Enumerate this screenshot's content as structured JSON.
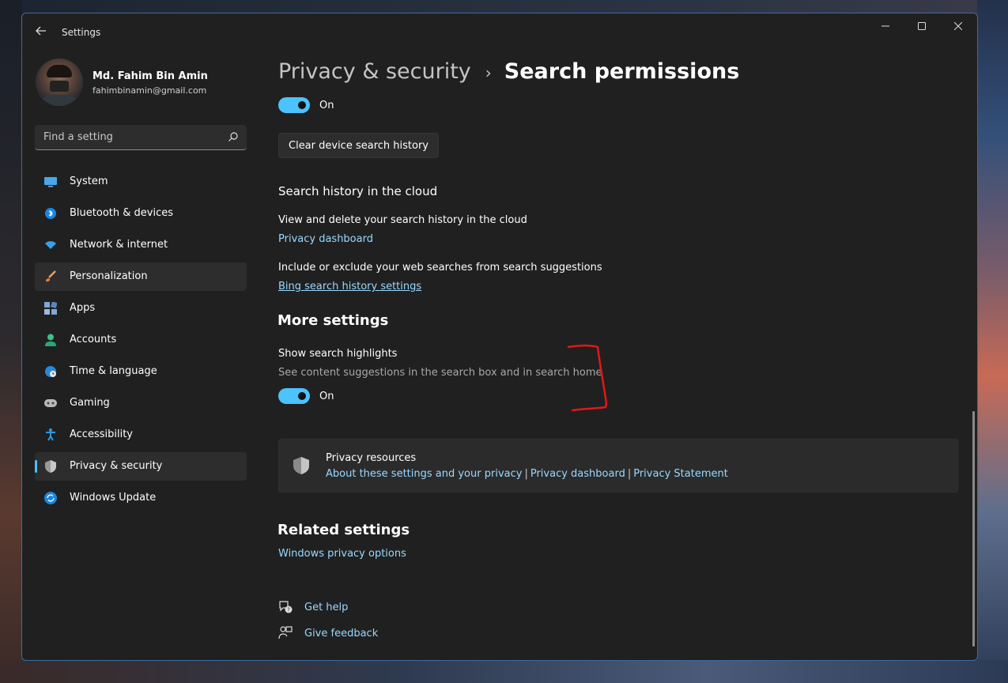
{
  "window": {
    "app_title": "Settings",
    "back_icon": "arrow-left-icon",
    "controls": [
      "minimize-icon",
      "maximize-icon",
      "close-icon"
    ]
  },
  "profile": {
    "name": "Md. Fahim Bin Amin",
    "email": "fahimbinamin@gmail.com"
  },
  "search": {
    "placeholder": "Find a setting"
  },
  "sidebar": {
    "items": [
      {
        "label": "System",
        "icon": "system-icon"
      },
      {
        "label": "Bluetooth & devices",
        "icon": "bluetooth-icon"
      },
      {
        "label": "Network & internet",
        "icon": "wifi-icon"
      },
      {
        "label": "Personalization",
        "icon": "brush-icon"
      },
      {
        "label": "Apps",
        "icon": "apps-icon"
      },
      {
        "label": "Accounts",
        "icon": "accounts-icon"
      },
      {
        "label": "Time & language",
        "icon": "globe-clock-icon"
      },
      {
        "label": "Gaming",
        "icon": "gamepad-icon"
      },
      {
        "label": "Accessibility",
        "icon": "accessibility-icon"
      },
      {
        "label": "Privacy & security",
        "icon": "shield-icon"
      },
      {
        "label": "Windows Update",
        "icon": "update-icon"
      }
    ],
    "selected": "Privacy & security",
    "hovered": "Personalization"
  },
  "breadcrumb": {
    "parent": "Privacy & security",
    "separator": "›",
    "current": "Search permissions"
  },
  "device_history": {
    "toggle_state": "On",
    "clear_button": "Clear device search history"
  },
  "cloud_history": {
    "heading": "Search history in the cloud",
    "view_delete_text": "View and delete your search history in the cloud",
    "privacy_dashboard_link": "Privacy dashboard",
    "include_exclude_text": "Include or exclude your web searches from search suggestions",
    "bing_link": "Bing search history settings"
  },
  "more_settings": {
    "heading": "More settings",
    "highlights_title": "Show search highlights",
    "highlights_desc": "See content suggestions in the search box and in search home",
    "toggle_state": "On"
  },
  "privacy_resources": {
    "title": "Privacy resources",
    "links": [
      "About these settings and your privacy",
      "Privacy dashboard",
      "Privacy Statement"
    ],
    "separator": "|"
  },
  "related": {
    "heading": "Related settings",
    "link": "Windows privacy options"
  },
  "help": {
    "get_help": "Get help",
    "give_feedback": "Give feedback"
  },
  "colors": {
    "accent": "#4cc2ff",
    "link": "#99d8ff",
    "annotation": "#e0181b",
    "window_bg": "#202020"
  }
}
